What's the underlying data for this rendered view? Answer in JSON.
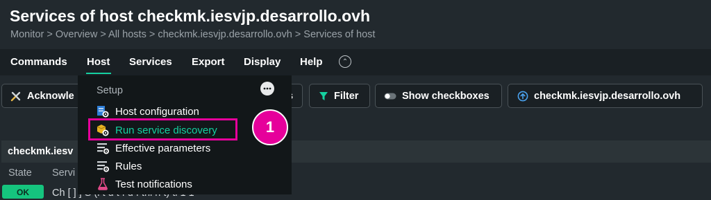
{
  "page": {
    "title": "Services of host checkmk.iesvjp.desarrollo.ovh",
    "breadcrumb": "Monitor > Overview > All hosts > checkmk.iesvjp.desarrollo.ovh > Services of host"
  },
  "menubar": {
    "items": [
      {
        "label": "Commands"
      },
      {
        "label": "Host",
        "active": true
      },
      {
        "label": "Services"
      },
      {
        "label": "Export"
      },
      {
        "label": "Display"
      },
      {
        "label": "Help"
      }
    ],
    "collapse_icon": "chevron-up-icon"
  },
  "toolbar": {
    "acknowledge_label": "Acknowle",
    "services_fragment": "s",
    "filter_label": "Filter",
    "checkboxes_label": "Show checkboxes",
    "host_label": "checkmk.iesvjp.desarrollo.ovh"
  },
  "host_panel": {
    "title": "checkmk.iesv",
    "columns": [
      "State",
      "Servi"
    ]
  },
  "row": {
    "state": "OK",
    "text": "Ch                                              [ ]                ] S         (l t     d t  f  d f  thi  h  t)           ti     1 1"
  },
  "dropdown": {
    "section": "Setup",
    "items": [
      {
        "label": "Host configuration",
        "icon": "host-config-icon"
      },
      {
        "label": "Run service discovery",
        "icon": "service-discovery-icon",
        "highlighted": true
      },
      {
        "label": "Effective parameters",
        "icon": "parameters-icon"
      },
      {
        "label": "Rules",
        "icon": "rules-icon"
      },
      {
        "label": "Test notifications",
        "icon": "flask-icon"
      }
    ]
  },
  "annotation": {
    "step_number": "1"
  },
  "colors": {
    "background": "#22292e",
    "menubar": "#1a2024",
    "accent": "#15d1a0",
    "annotation": "#e6009b",
    "ok": "#15c47e"
  }
}
